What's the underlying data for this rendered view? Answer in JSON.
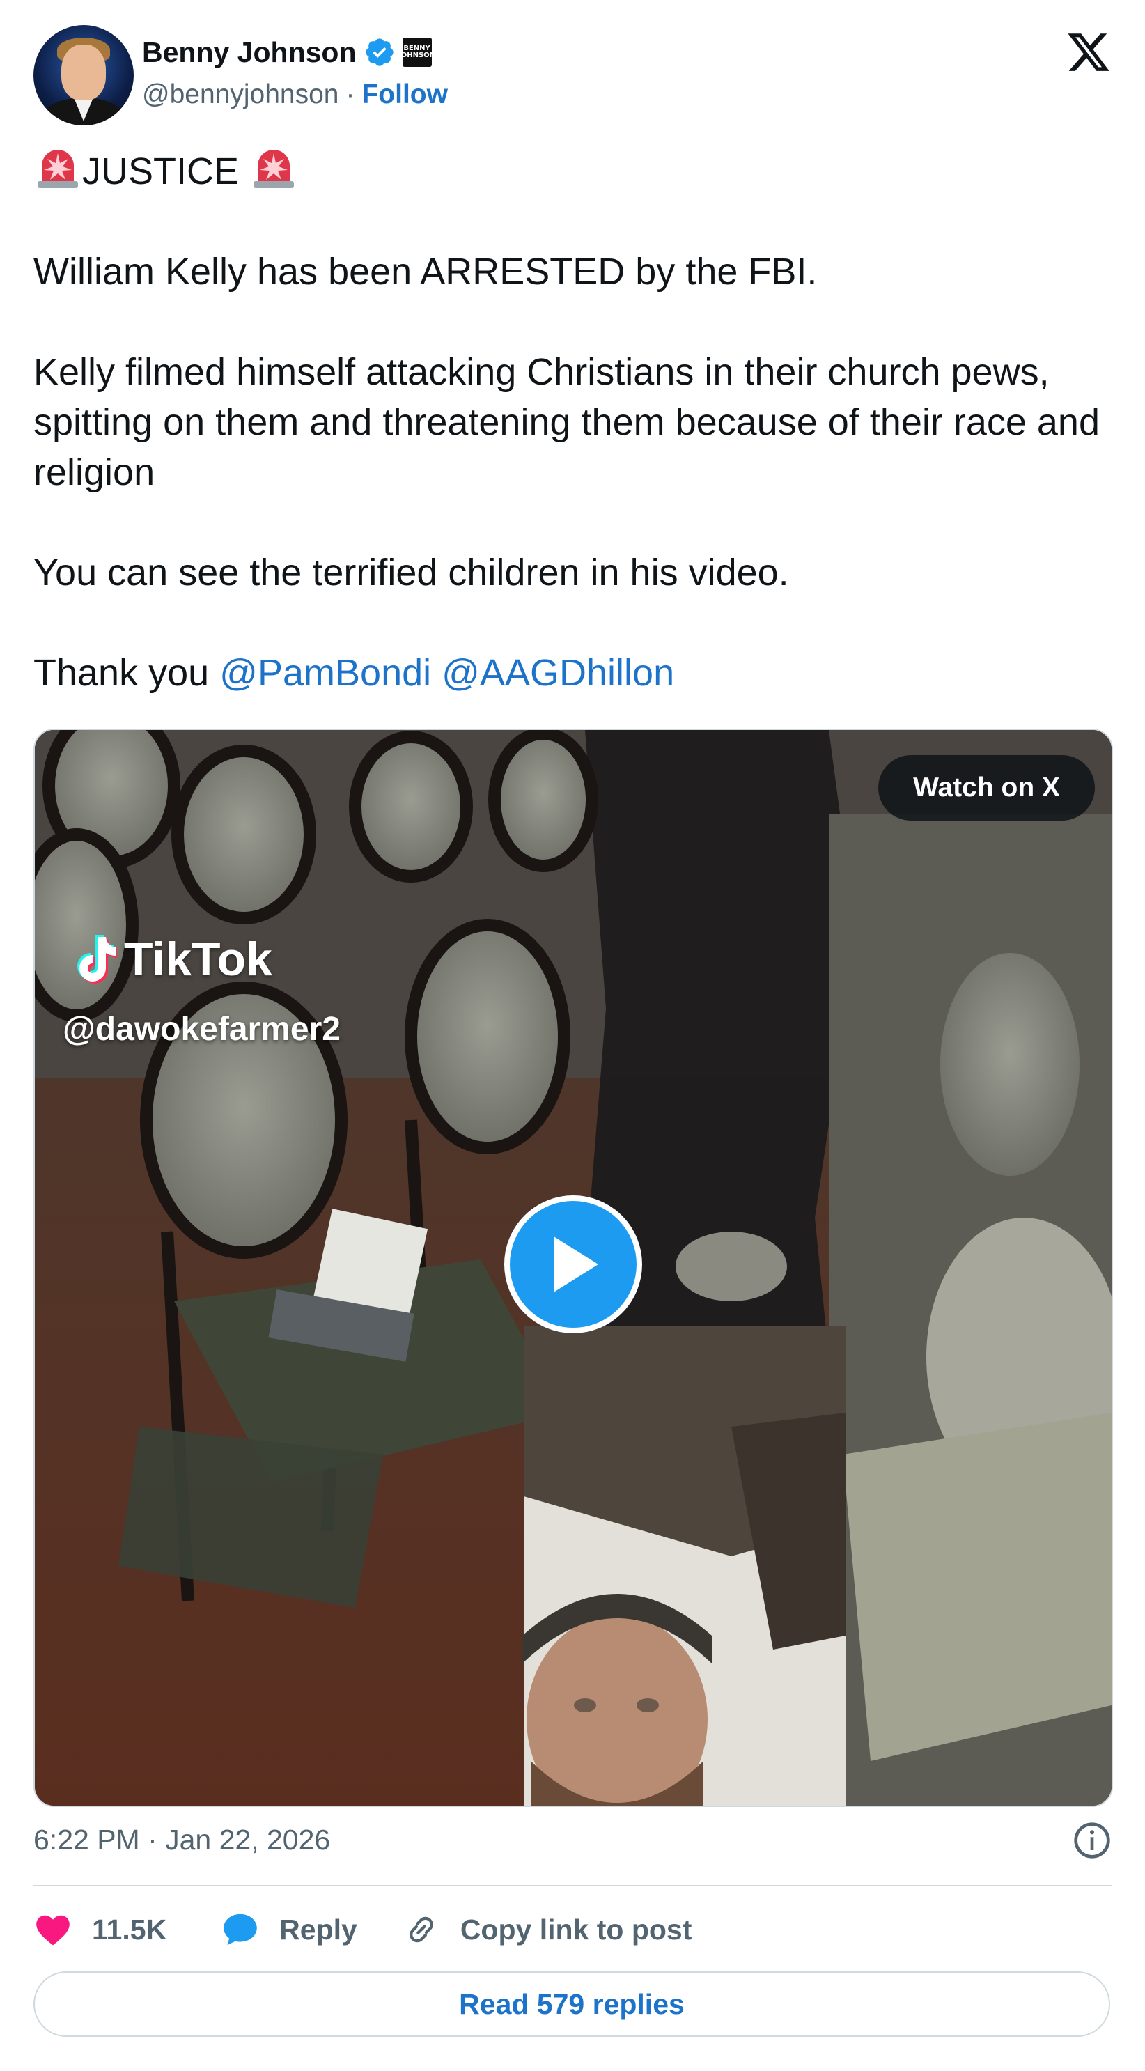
{
  "author": {
    "display_name": "Benny Johnson",
    "handle": "@bennyjohnson",
    "separator": "·",
    "follow_label": "Follow",
    "affiliate_badge_text": "BENNY JOHNSON"
  },
  "tweet": {
    "headline": "JUSTICE",
    "lines": [
      "William Kelly has been ARRESTED by the FBI.",
      "Kelly filmed himself attacking Christians in their church pews, spitting on them and threatening them because of their race and religion",
      "You can see the terrified children in his video."
    ],
    "thanks_prefix": "Thank you",
    "mentions": [
      "@PamBondi",
      "@AAGDhillon"
    ]
  },
  "media": {
    "watch_label": "Watch on X",
    "tiktok_brand": "TikTok",
    "tiktok_user": "@dawokefarmer2"
  },
  "meta": {
    "timestamp": "6:22 PM · Jan 22, 2026"
  },
  "actions": {
    "likes": "11.5K",
    "reply_label": "Reply",
    "copy_label": "Copy link to post",
    "read_replies_label": "Read 579 replies"
  },
  "icons": {
    "brand": "x-logo",
    "verified": "verified-badge-icon",
    "siren": "police-light-emoji",
    "like": "heart-icon",
    "reply": "speech-bubble-icon",
    "copy": "link-icon",
    "info": "info-icon",
    "play": "play-icon"
  },
  "colors": {
    "link": "#1d73c9",
    "verified": "#1d9bf0",
    "heart": "#f91880",
    "secondary_text": "#536471",
    "border": "#cfd9de"
  }
}
